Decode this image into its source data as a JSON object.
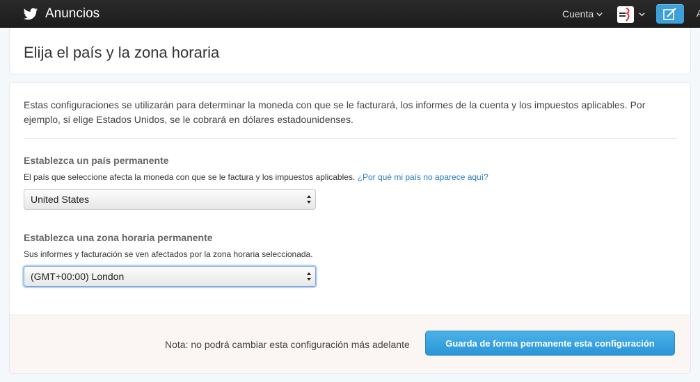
{
  "topbar": {
    "brand_label": "Anuncios",
    "account_label": "Cuenta",
    "cut_letter": "A",
    "icons": {
      "logo": "twitter-bird-icon",
      "account_chevron": "chevron-down-icon",
      "avatar": "user-avatar",
      "compose": "compose-icon"
    },
    "colors": {
      "bar": "#222222",
      "compose": "#3ea0d8"
    }
  },
  "header": {
    "title": "Elija el país y la zona horaria"
  },
  "main": {
    "intro": "Estas configuraciones se utilizarán para determinar la moneda con que se le facturará, los informes de la cuenta y los impuestos aplicables. Por ejemplo, si elige Estados Unidos, se le cobrará en dólares estadounidenses.",
    "country": {
      "title": "Establezca un país permanente",
      "description": "El país que seleccione afecta la moneda con que se le factura y los impuestos aplicables.",
      "help_link": "¿Por qué mi país no aparece aquí?",
      "selected": "United States"
    },
    "timezone": {
      "title": "Establezca una zona horaria permanente",
      "description": "Sus informes y facturación se ven afectados por la zona horaria seleccionada.",
      "selected": "(GMT+00:00) London"
    }
  },
  "footer": {
    "note": "Nota: no podrá cambiar esta configuración más adelante",
    "save_label": "Guarda de forma permanente esta configuración",
    "button_color": "#2b95d6"
  }
}
